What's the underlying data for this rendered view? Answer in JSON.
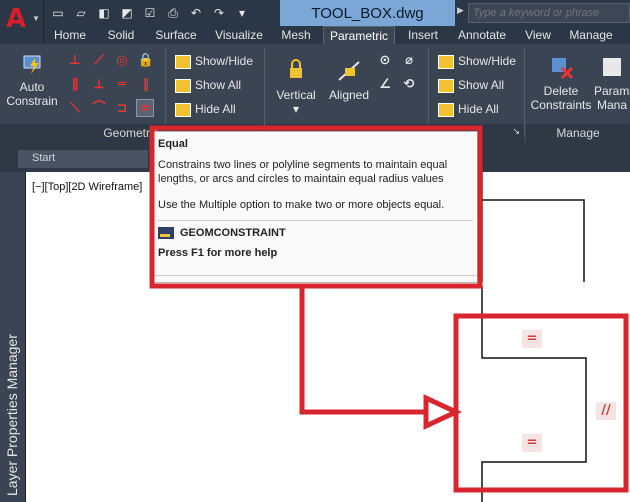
{
  "app": {
    "logo": "A",
    "document_title": "TOOL_BOX.dwg"
  },
  "search": {
    "placeholder": "Type a keyword or phrase"
  },
  "quick_access": [
    "new-icon",
    "open-icon",
    "save-icon",
    "saveas-icon",
    "checklist-icon",
    "print-icon",
    "undo-icon",
    "redo-icon",
    "dropdown-icon"
  ],
  "tabs": [
    "Home",
    "Solid",
    "Surface",
    "Visualize",
    "Mesh",
    "Parametric",
    "Insert",
    "Annotate",
    "View",
    "Manage"
  ],
  "active_tab": "Parametric",
  "ribbon": {
    "auto_constrain": {
      "line1": "Auto",
      "line2": "Constrain"
    },
    "geometric_panel_label": "Geometric",
    "geo_show_hide": "Show/Hide",
    "geo_show_all": "Show All",
    "geo_hide_all": "Hide All",
    "vertical_label": "Vertical",
    "aligned_label": "Aligned",
    "dim_show_hide": "Show/Hide",
    "dim_show_all": "Show All",
    "dim_hide_all": "Hide All",
    "delete_constraints": {
      "line1": "Delete",
      "line2": "Constraints"
    },
    "parametric_manager": {
      "line1": "Parame",
      "line2": "Mana"
    },
    "manage_panel_label": "Manage"
  },
  "file_tabs": {
    "start": "Start"
  },
  "viewport": {
    "label": "[−][Top][2D Wireframe]"
  },
  "side_panel": {
    "label": "Layer Properties Manager"
  },
  "tooltip": {
    "title": "Equal",
    "description": "Constrains two lines or polyline segments to maintain equal lengths, or arcs and circles to maintain equal radius values",
    "note": "Use the Multiple option to make two or more objects equal.",
    "command": "GEOMCONSTRAINT",
    "help": "Press F1 for more help"
  },
  "constraint_markers": {
    "equal_upper": "=",
    "equal_lower": "=",
    "parallel": "//"
  },
  "colors": {
    "annotation_red": "#d7262e",
    "ribbon_bg": "#3b4453",
    "title_bar": "#2b3646",
    "doc_title_bg": "#7aa7d6"
  }
}
